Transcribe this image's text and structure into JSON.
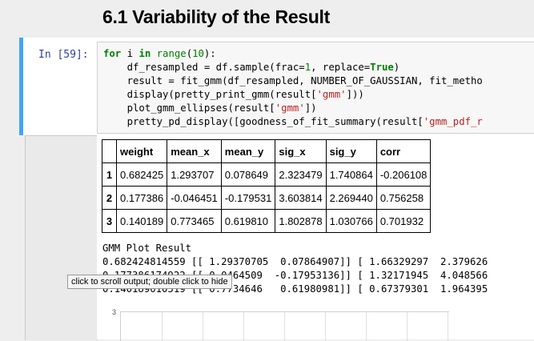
{
  "section_title": "6.1 Variability of the Result",
  "input_prompt": "In [59]:",
  "code_lines": [
    [
      {
        "t": "for",
        "c": "kw"
      },
      {
        "t": " i "
      },
      {
        "t": "in",
        "c": "kw"
      },
      {
        "t": " "
      },
      {
        "t": "range",
        "c": "bi"
      },
      {
        "t": "("
      },
      {
        "t": "10",
        "c": "num"
      },
      {
        "t": "):"
      }
    ],
    [
      {
        "t": "    df_resampled = df.sample(frac="
      },
      {
        "t": "1",
        "c": "num"
      },
      {
        "t": ", replace="
      },
      {
        "t": "True",
        "c": "kw"
      },
      {
        "t": ")"
      }
    ],
    [
      {
        "t": "    result = fit_gmm(df_resampled, NUMBER_OF_GAUSSIAN, fit_metho"
      }
    ],
    [
      {
        "t": "    display(pretty_print_gmm(result["
      },
      {
        "t": "'gmm'",
        "c": "str"
      },
      {
        "t": "]))"
      }
    ],
    [
      {
        "t": "    plot_gmm_ellipses(result["
      },
      {
        "t": "'gmm'",
        "c": "str"
      },
      {
        "t": "])"
      }
    ],
    [
      {
        "t": "    pretty_pd_display([goodness_of_fit_summary(result["
      },
      {
        "t": "'gmm_pdf_r",
        "c": "str"
      }
    ]
  ],
  "table": {
    "columns": [
      "",
      "weight",
      "mean_x",
      "mean_y",
      "sig_x",
      "sig_y",
      "corr"
    ],
    "rows": [
      [
        "1",
        "0.682425",
        "1.293707",
        "0.078649",
        "2.323479",
        "1.740864",
        "-0.206108"
      ],
      [
        "2",
        "0.177386",
        "-0.046451",
        "-0.179531",
        "3.603814",
        "2.269440",
        "0.756258"
      ],
      [
        "3",
        "0.140189",
        "0.773465",
        "0.619810",
        "1.802878",
        "1.030766",
        "0.701932"
      ]
    ]
  },
  "gmm_output": {
    "heading": "GMM Plot Result",
    "lines": [
      "0.682424814559 [[ 1.29370705  0.07864907]] [ 1.66329297  2.379626",
      "0.177386174922 [[-0.0464509  -0.17953136]] [ 1.32171945  4.048566",
      "0.140189010519 [[ 0.7734646   0.61980981]] [ 0.67379301  1.964395"
    ]
  },
  "tooltip": "click to scroll output; double click to hide",
  "plot": {
    "y_tick_top": "3",
    "vertical_gridlines": 8
  }
}
